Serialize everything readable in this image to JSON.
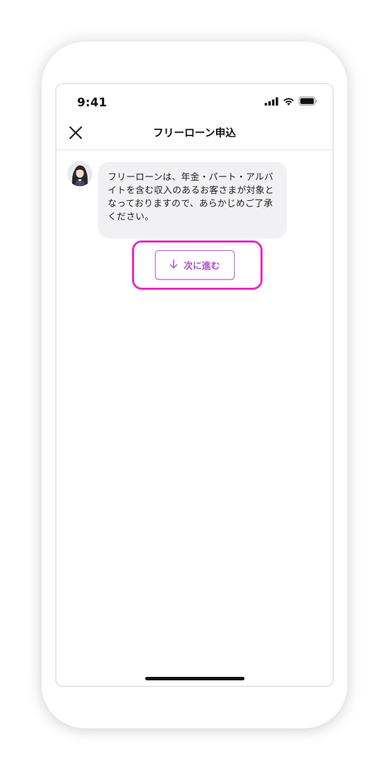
{
  "status_bar": {
    "time": "9:41",
    "icons": [
      "cellular-signal-icon",
      "wifi-icon",
      "battery-icon"
    ]
  },
  "header": {
    "title": "フリーローン申込",
    "close_icon": "close-icon"
  },
  "chat": {
    "avatar_icon": "operator-avatar",
    "message": "フリーローンは、年金・パート・アルバイトを含む収入のあるお客さまが対象となっておりますので、あらかじめご了承ください。"
  },
  "actions": {
    "next_label": "次に進む",
    "next_icon": "arrow-down-icon"
  },
  "colors": {
    "accent_purple": "#b04fcb",
    "highlight_magenta": "#ea2bc1",
    "bubble_bg": "#f1f1f3"
  }
}
